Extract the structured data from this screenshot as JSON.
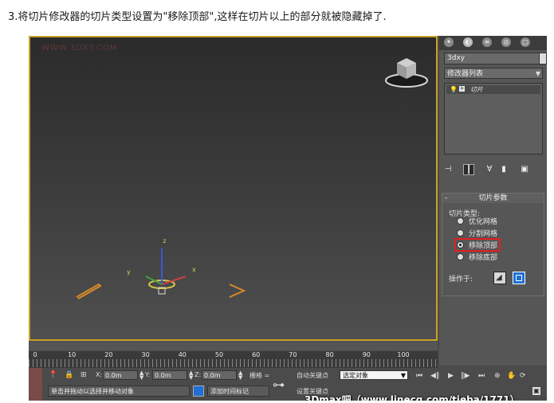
{
  "caption": "3.将切片修改器的切片类型设置为\"移除顶部\",这样在切片以上的部分就被隐藏掉了.",
  "viewport": {
    "watermark": "WWW.3DXY.COM",
    "axis_z": "z",
    "axis_x": "x",
    "axis_y": "y"
  },
  "panel": {
    "object_name": "3dxy",
    "modifier_list": "修改器列表",
    "stack_item": "切片",
    "rollout_title": "切片参数",
    "slice_type_label": "切片类型:",
    "options": [
      "优化网格",
      "分割网格",
      "移除顶部",
      "移除底部"
    ],
    "selected_option": "移除顶部",
    "operate_on_label": "操作于:"
  },
  "timeline": {
    "ticks": [
      "0",
      "10",
      "20",
      "30",
      "40",
      "50",
      "60",
      "70",
      "80",
      "90",
      "100"
    ]
  },
  "status": {
    "x_label": "X:",
    "y_label": "Y:",
    "z_label": "Z:",
    "x_value": "0.0m",
    "y_value": "0.0m",
    "z_value": "0.0m",
    "grid_label": "栅格 =",
    "prompt": "单击并拖动以选择并移动对象",
    "add_time_tag": "添加时间标记",
    "auto_key": "自动关键点",
    "selected_object": "选定对象",
    "set_key": "设置关键点",
    "watermark_banner": "3Dmax吧（www.linecg.com/tieba/1771）"
  },
  "colors": {
    "highlight": "#e02020",
    "viewport_border": "#c9a227",
    "accent_blue": "#1f6fd6"
  }
}
